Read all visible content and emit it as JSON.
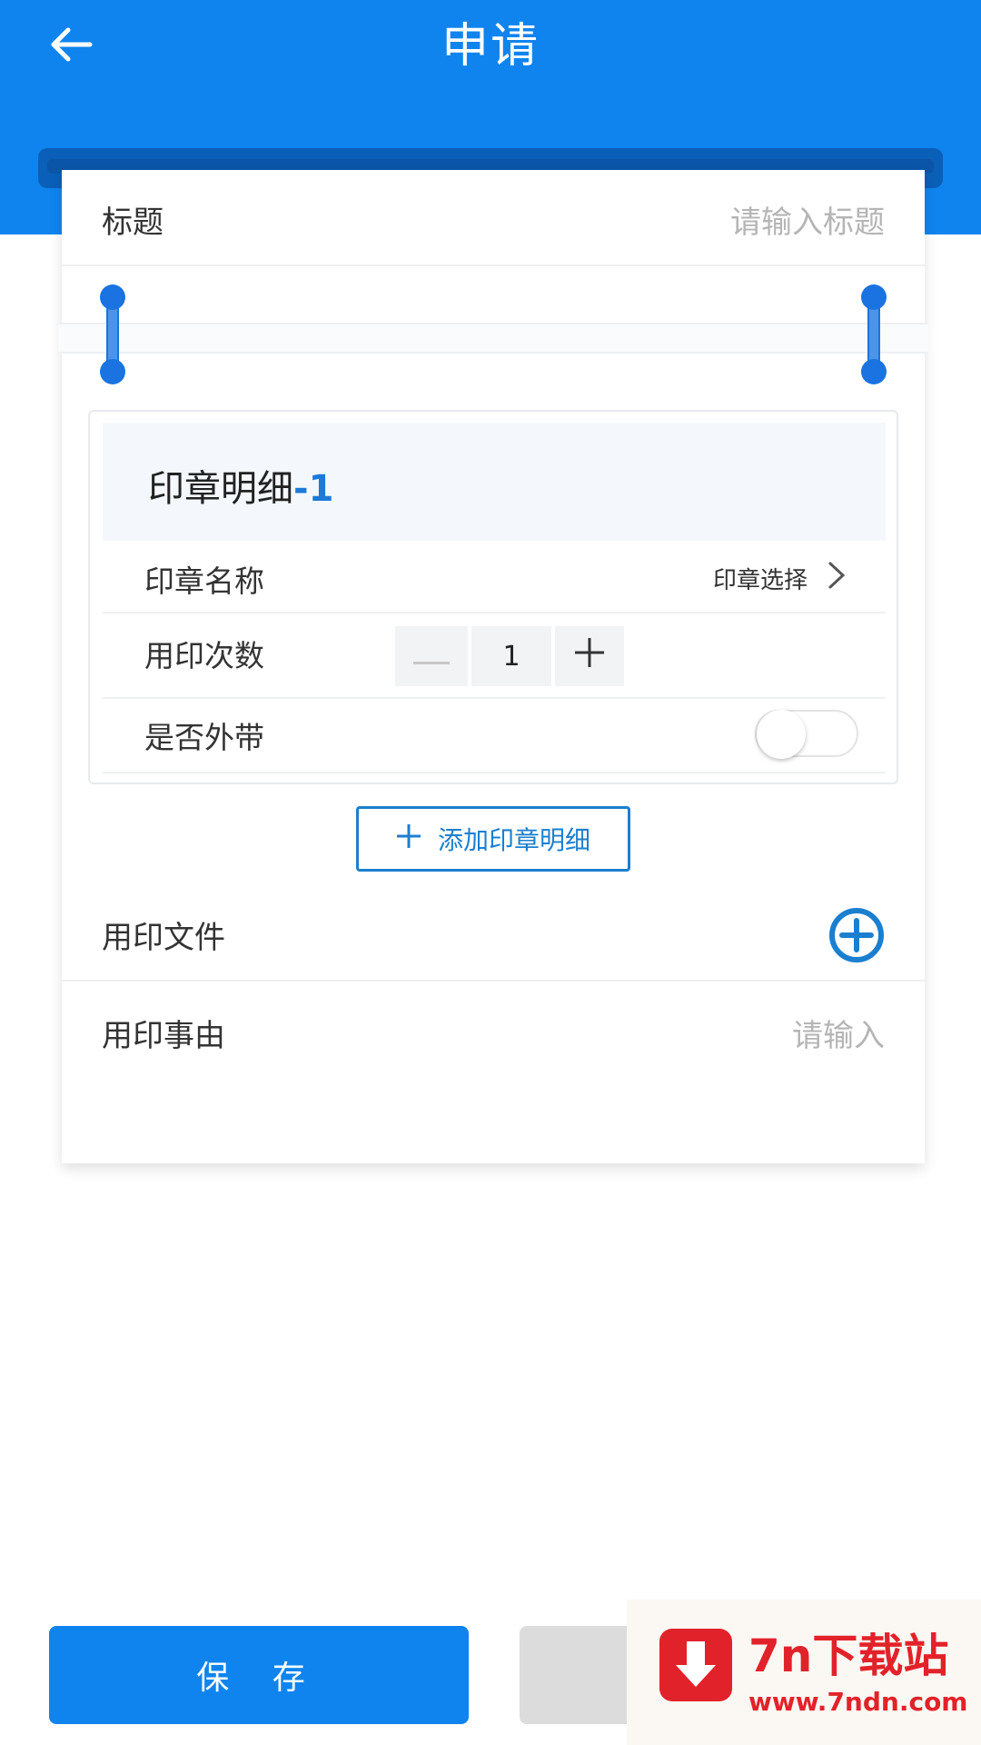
{
  "header": {
    "title": "申请",
    "back_icon": "arrow-left-icon"
  },
  "form": {
    "title_label": "标题",
    "title_placeholder": "请输入标题",
    "seal_detail": {
      "heading": "印章明细",
      "index": "-1",
      "seal_name_label": "印章名称",
      "seal_select_label": "印章选择",
      "usage_count_label": "用印次数",
      "usage_count_value": "1",
      "take_out_label": "是否外带",
      "take_out_enabled": false
    },
    "add_detail_label": "添加印章明细",
    "file_label": "用印文件",
    "reason_label": "用印事由",
    "reason_placeholder": "请输入"
  },
  "footer": {
    "save_label": "保 存"
  },
  "watermark": {
    "brand": "7n下载站",
    "url": "www.7ndn.com"
  },
  "colors": {
    "primary": "#0f84ef",
    "accent": "#1b7fcf",
    "placeholder": "#b5b5b5"
  }
}
